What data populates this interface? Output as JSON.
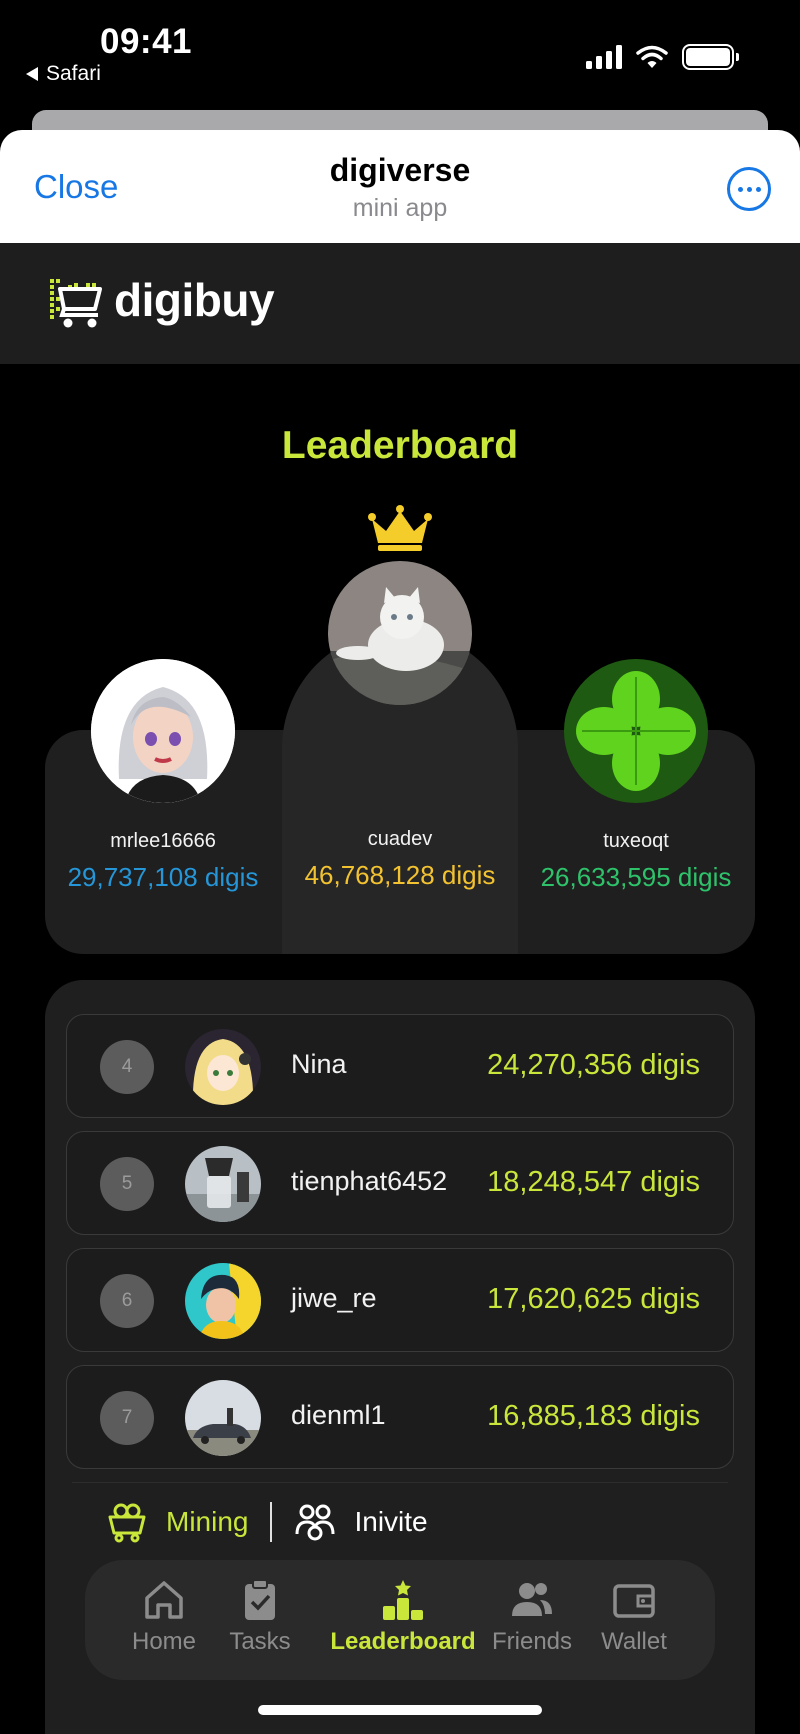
{
  "status_bar": {
    "time": "09:41",
    "back_label": "Safari"
  },
  "sheet": {
    "close_label": "Close",
    "title": "digiverse",
    "subtitle": "mini app"
  },
  "brand": {
    "name": "digibuy",
    "accent": "#c9e63a"
  },
  "leaderboard": {
    "title": "Leaderboard",
    "podium": [
      {
        "position": "second",
        "name": "mrlee16666",
        "score": "29,737,108 digis",
        "color": "#2596d8",
        "avatar": "girl-avatar"
      },
      {
        "position": "first",
        "name": "cuadev",
        "score": "46,768,128 digis",
        "color": "#f2c230",
        "avatar": "cat-avatar"
      },
      {
        "position": "third",
        "name": "tuxeoqt",
        "score": "26,633,595 digis",
        "color": "#2ec36b",
        "avatar": "clover-avatar"
      }
    ],
    "rows": [
      {
        "rank": "4",
        "name": "Nina",
        "score": "24,270,356 digis",
        "avatar": "anime-avatar"
      },
      {
        "rank": "5",
        "name": "tienphat6452",
        "score": "18,248,547 digis",
        "avatar": "coffee-avatar"
      },
      {
        "rank": "6",
        "name": "jiwe_re",
        "score": "17,620,625 digis",
        "avatar": "boy-avatar"
      },
      {
        "rank": "7",
        "name": "dienml1",
        "score": "16,885,183 digis",
        "avatar": "car-avatar"
      }
    ]
  },
  "actions": {
    "mining_label": "Mining",
    "invite_label": "Inivite"
  },
  "nav": {
    "items": [
      {
        "label": "Home",
        "icon": "home-icon"
      },
      {
        "label": "Tasks",
        "icon": "clipboard-icon"
      },
      {
        "label": "Leaderboard",
        "icon": "podium-icon",
        "active": true
      },
      {
        "label": "Friends",
        "icon": "friends-icon"
      },
      {
        "label": "Wallet",
        "icon": "wallet-icon"
      }
    ]
  }
}
